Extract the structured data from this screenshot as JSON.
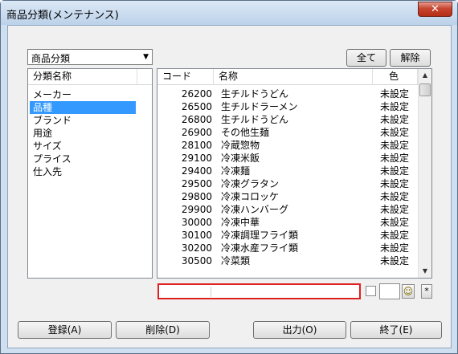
{
  "window": {
    "title": "商品分類(メンテナンス)",
    "close_label": "✕"
  },
  "category_select": {
    "value": "商品分類"
  },
  "buttons": {
    "all": "全て",
    "clear": "解除",
    "register": "登録(A)",
    "delete": "削除(D)",
    "output": "出力(O)",
    "exit": "終了(E)",
    "star": "*"
  },
  "left_list": {
    "header": "分類名称",
    "items": [
      "メーカー",
      "品種",
      "ブランド",
      "用途",
      "サイズ",
      "プライス",
      "仕入先"
    ],
    "selected_index": 1
  },
  "right_list": {
    "headers": {
      "code": "コード",
      "name": "名称",
      "color": "色"
    },
    "rows": [
      {
        "code": "26200",
        "name": "生チルドうどん",
        "color": "未設定"
      },
      {
        "code": "26500",
        "name": "生チルドラーメン",
        "color": "未設定"
      },
      {
        "code": "26800",
        "name": "生チルドうどん",
        "color": "未設定"
      },
      {
        "code": "26900",
        "name": "その他生麺",
        "color": "未設定"
      },
      {
        "code": "28100",
        "name": "冷蔵惣物",
        "color": "未設定"
      },
      {
        "code": "29100",
        "name": "冷凍米飯",
        "color": "未設定"
      },
      {
        "code": "29400",
        "name": "冷凍麺",
        "color": "未設定"
      },
      {
        "code": "29500",
        "name": "冷凍グラタン",
        "color": "未設定"
      },
      {
        "code": "29800",
        "name": "冷凍コロッケ",
        "color": "未設定"
      },
      {
        "code": "29900",
        "name": "冷凍ハンバーグ",
        "color": "未設定"
      },
      {
        "code": "30000",
        "name": "冷凍中華",
        "color": "未設定"
      },
      {
        "code": "30100",
        "name": "冷凍調理フライ類",
        "color": "未設定"
      },
      {
        "code": "30200",
        "name": "冷凍水産フライ類",
        "color": "未設定"
      },
      {
        "code": "30500",
        "name": "冷菜類",
        "color": "未設定"
      }
    ]
  },
  "search": {
    "value": ""
  },
  "icons": {
    "close": "close-icon",
    "dropdown": "chevron-down-icon",
    "scroll_up": "scroll-up-icon",
    "scroll_down": "scroll-down-icon",
    "smiley": "smiley-icon"
  },
  "colors": {
    "highlight": "#3399ff",
    "search_border": "#e02020",
    "close_button": "#c7452f"
  }
}
